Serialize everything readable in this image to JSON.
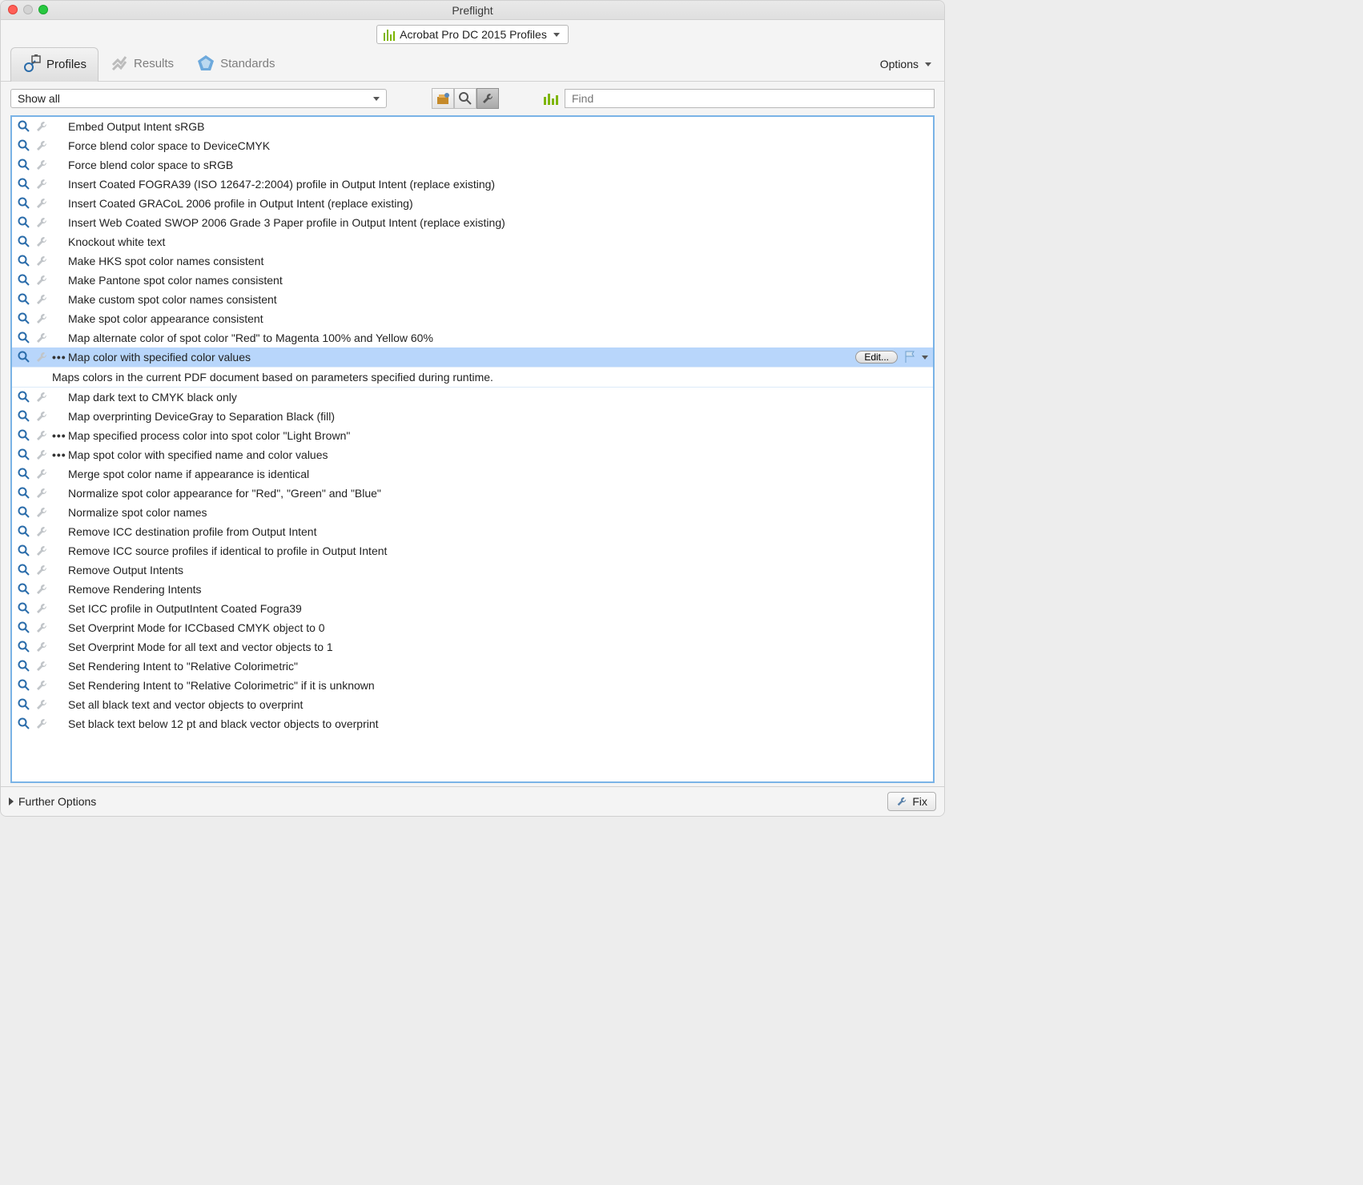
{
  "window": {
    "title": "Preflight"
  },
  "profileSet": {
    "label": "Acrobat Pro DC 2015 Profiles"
  },
  "tabs": {
    "profiles": "Profiles",
    "results": "Results",
    "standards": "Standards"
  },
  "options": {
    "label": "Options"
  },
  "filter": {
    "label": "Show all"
  },
  "find": {
    "placeholder": "Find"
  },
  "selected": {
    "editLabel": "Edit...",
    "description": "Maps colors in the current PDF document based on parameters specified during runtime."
  },
  "items": [
    {
      "label": "Embed Output Intent sRGB"
    },
    {
      "label": "Force blend color space to DeviceCMYK"
    },
    {
      "label": "Force blend color space to sRGB"
    },
    {
      "label": "Insert Coated FOGRA39 (ISO 12647-2:2004) profile in Output Intent (replace existing)"
    },
    {
      "label": "Insert Coated GRACoL 2006 profile in Output Intent (replace existing)"
    },
    {
      "label": "Insert Web Coated SWOP 2006 Grade 3 Paper profile in Output Intent (replace existing)"
    },
    {
      "label": "Knockout white text"
    },
    {
      "label": "Make HKS spot color names consistent"
    },
    {
      "label": "Make Pantone spot color names consistent"
    },
    {
      "label": "Make custom spot color names consistent"
    },
    {
      "label": "Make spot color appearance consistent"
    },
    {
      "label": "Map alternate color of spot color \"Red\" to Magenta 100% and Yellow 60%"
    },
    {
      "label": "Map color with specified color values",
      "selected": true,
      "dots": true
    },
    {
      "label": "Map dark text to CMYK black only"
    },
    {
      "label": "Map overprinting DeviceGray to Separation Black (fill)"
    },
    {
      "label": "Map specified process color into spot color \"Light Brown\"",
      "dots": true
    },
    {
      "label": "Map spot color with specified name and color values",
      "dots": true
    },
    {
      "label": "Merge spot color name if appearance is identical"
    },
    {
      "label": "Normalize spot color appearance for \"Red\", \"Green\" and \"Blue\""
    },
    {
      "label": "Normalize spot color names"
    },
    {
      "label": "Remove ICC destination profile from Output Intent"
    },
    {
      "label": "Remove ICC source profiles if identical to profile in Output Intent"
    },
    {
      "label": "Remove Output Intents"
    },
    {
      "label": "Remove Rendering Intents"
    },
    {
      "label": "Set ICC profile in OutputIntent Coated Fogra39"
    },
    {
      "label": "Set Overprint Mode for ICCbased CMYK object to 0"
    },
    {
      "label": "Set Overprint Mode for all text and vector objects to 1"
    },
    {
      "label": "Set Rendering Intent to \"Relative Colorimetric\""
    },
    {
      "label": "Set Rendering Intent to \"Relative Colorimetric\" if it is unknown"
    },
    {
      "label": "Set all black text and vector objects to overprint"
    },
    {
      "label": "Set black text below 12 pt and black vector objects to overprint"
    }
  ],
  "footer": {
    "further": "Further Options",
    "fix": "Fix"
  }
}
